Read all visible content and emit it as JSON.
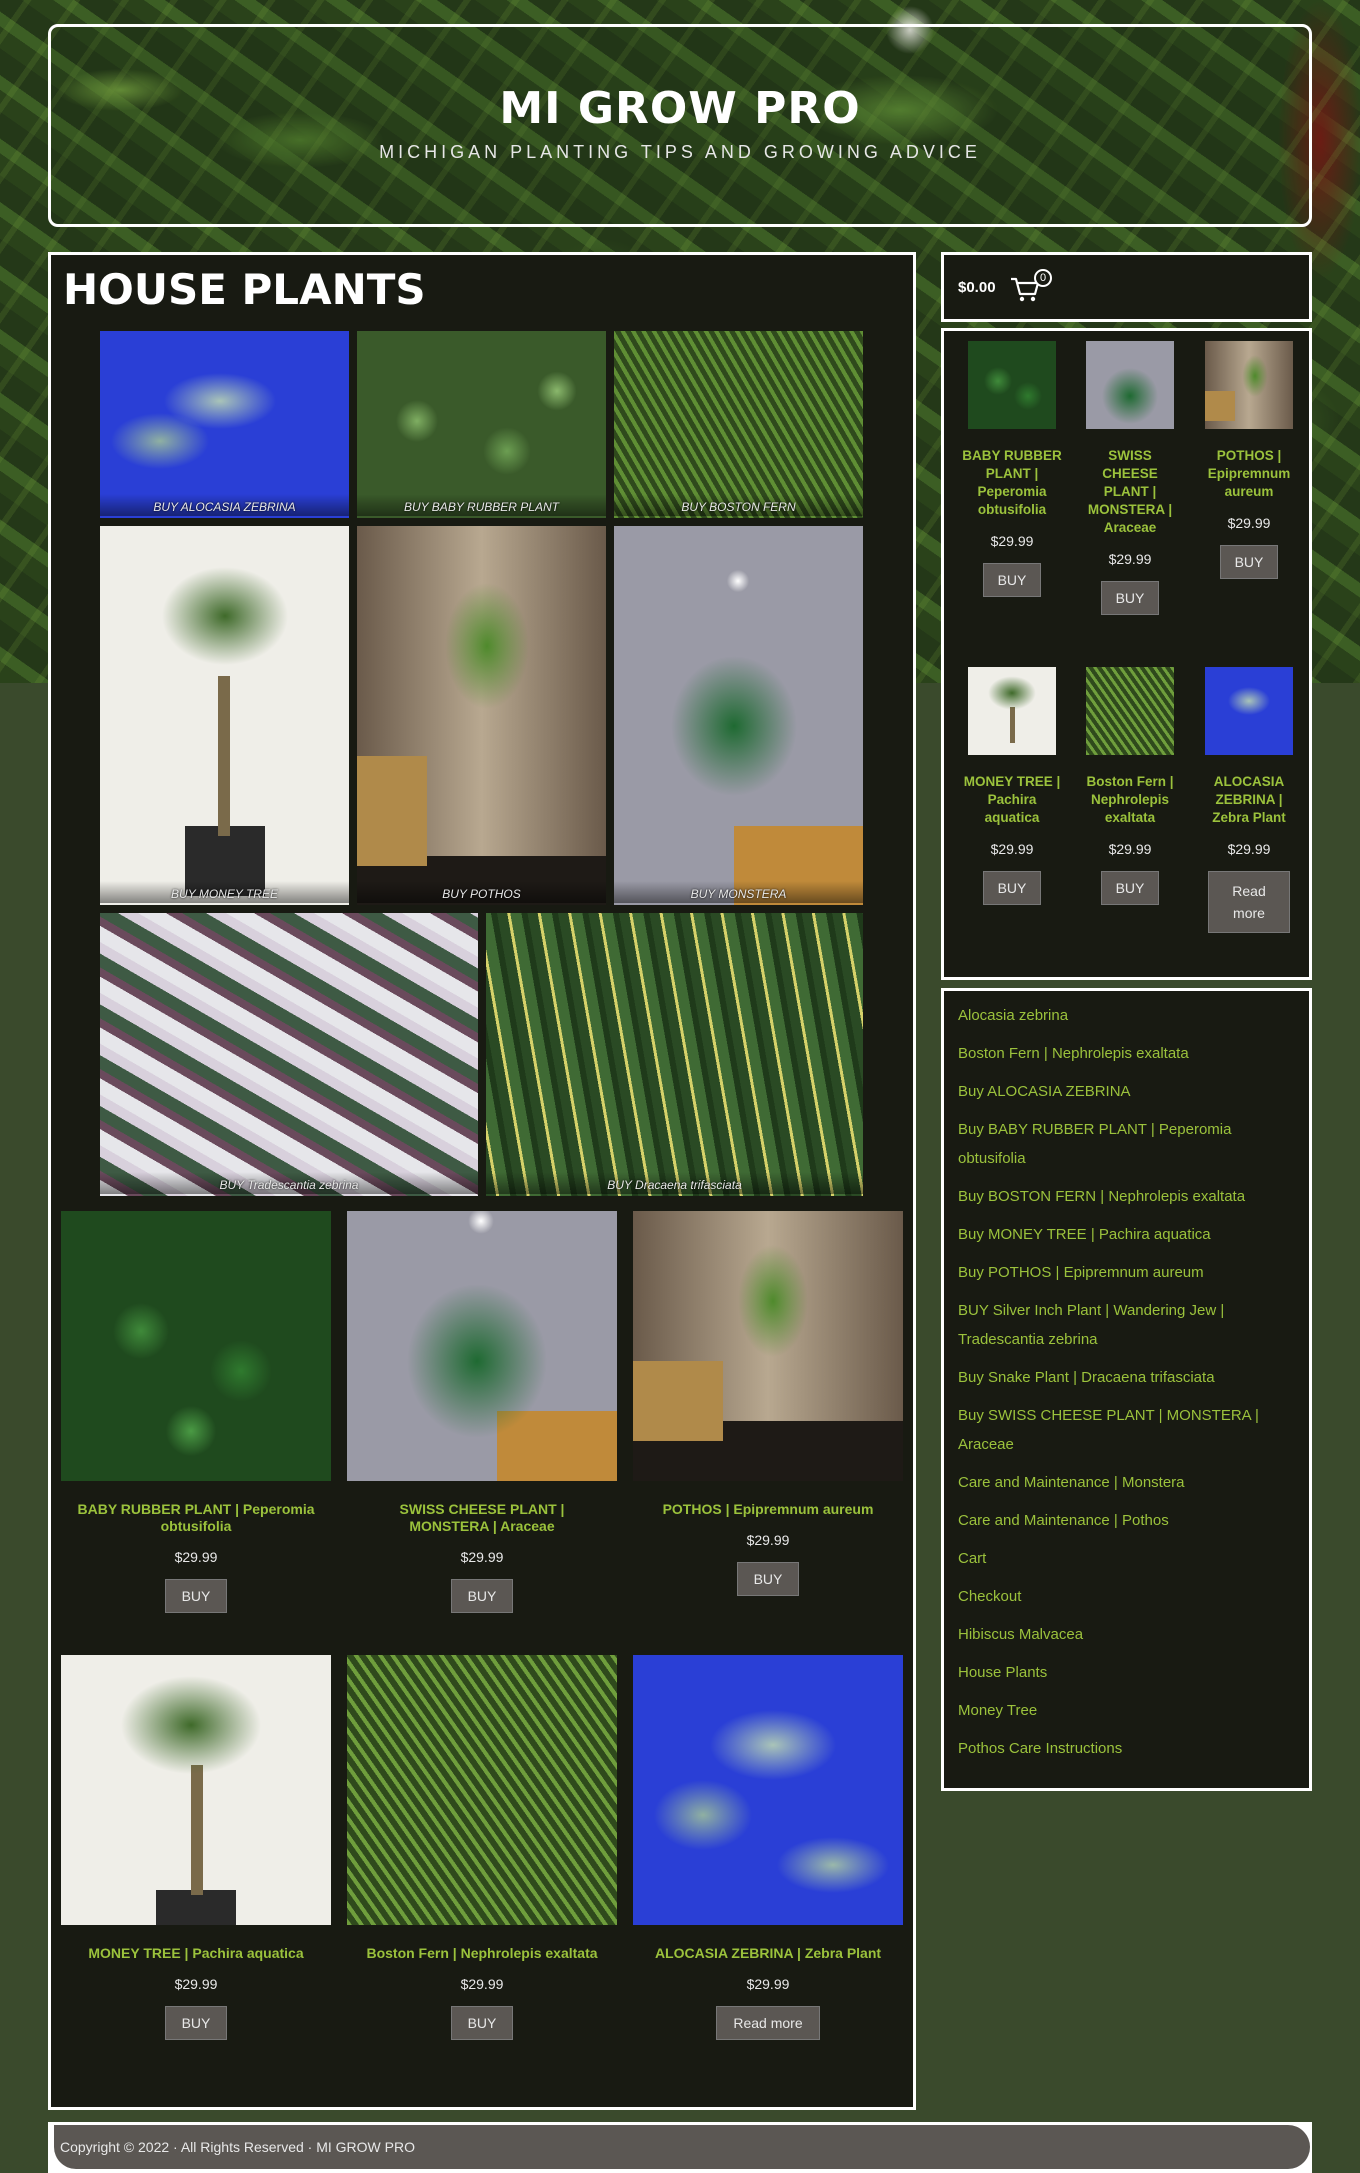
{
  "site": {
    "title": "MI GROW PRO",
    "tagline": "MICHIGAN PLANTING TIPS AND GROWING ADVICE"
  },
  "page_title": "HOUSE PLANTS",
  "gallery": [
    {
      "caption": "BUY ALOCASIA ZEBRINA"
    },
    {
      "caption": "BUY BABY RUBBER PLANT"
    },
    {
      "caption": "BUY BOSTON FERN"
    },
    {
      "caption": "BUY MONEY TREE"
    },
    {
      "caption": "BUY POTHOS"
    },
    {
      "caption": "BUY MONSTERA"
    },
    {
      "caption": "BUY Tradescantia zebrina"
    },
    {
      "caption": "BUY Dracaena trifasciata"
    }
  ],
  "products": [
    {
      "name": "BABY RUBBER PLANT | Peperomia obtusifolia",
      "price": "$29.99",
      "button": "BUY"
    },
    {
      "name": "SWISS CHEESE PLANT | MONSTERA | Araceae",
      "price": "$29.99",
      "button": "BUY"
    },
    {
      "name": "POTHOS | Epipremnum aureum",
      "price": "$29.99",
      "button": "BUY"
    },
    {
      "name": "MONEY TREE | Pachira aquatica",
      "price": "$29.99",
      "button": "BUY"
    },
    {
      "name": "Boston Fern | Nephrolepis exaltata",
      "price": "$29.99",
      "button": "BUY"
    },
    {
      "name": "ALOCASIA ZEBRINA | Zebra Plant",
      "price": "$29.99",
      "button": "Read more"
    }
  ],
  "cart": {
    "amount": "$0.00",
    "count": "0"
  },
  "sidebar_products": [
    {
      "name": "BABY RUBBER PLANT | Peperomia obtusifolia",
      "price": "$29.99",
      "button": "BUY"
    },
    {
      "name": "SWISS CHEESE PLANT | MONSTERA | Araceae",
      "price": "$29.99",
      "button": "BUY"
    },
    {
      "name": "POTHOS | Epipremnum aureum",
      "price": "$29.99",
      "button": "BUY"
    },
    {
      "name": "MONEY TREE | Pachira aquatica",
      "price": "$29.99",
      "button": "BUY"
    },
    {
      "name": "Boston Fern | Nephrolepis exaltata",
      "price": "$29.99",
      "button": "BUY"
    },
    {
      "name": "ALOCASIA ZEBRINA | Zebra Plant",
      "price": "$29.99",
      "button": "Read more"
    }
  ],
  "pages": [
    "Alocasia zebrina",
    "Boston Fern | Nephrolepis exaltata",
    "Buy ALOCASIA ZEBRINA",
    "Buy BABY RUBBER PLANT | Peperomia obtusifolia",
    "Buy BOSTON FERN | Nephrolepis exaltata",
    "Buy MONEY TREE | Pachira aquatica",
    "Buy POTHOS | Epipremnum aureum",
    "BUY Silver Inch Plant | Wandering Jew | Tradescantia zebrina",
    "Buy Snake Plant | Dracaena trifasciata",
    "Buy SWISS CHEESE PLANT | MONSTERA | Araceae",
    "Care and Maintenance | Monstera",
    "Care and Maintenance | Pothos",
    "Cart",
    "Checkout",
    "Hibiscus Malvacea",
    "House Plants",
    "Money Tree",
    "Pothos Care Instructions"
  ],
  "footer": "Copyright © 2022 · All Rights Reserved · MI GROW PRO",
  "colors": {
    "accent": "#9bc23c",
    "panel": "#181a12",
    "button": "#5b5753"
  }
}
